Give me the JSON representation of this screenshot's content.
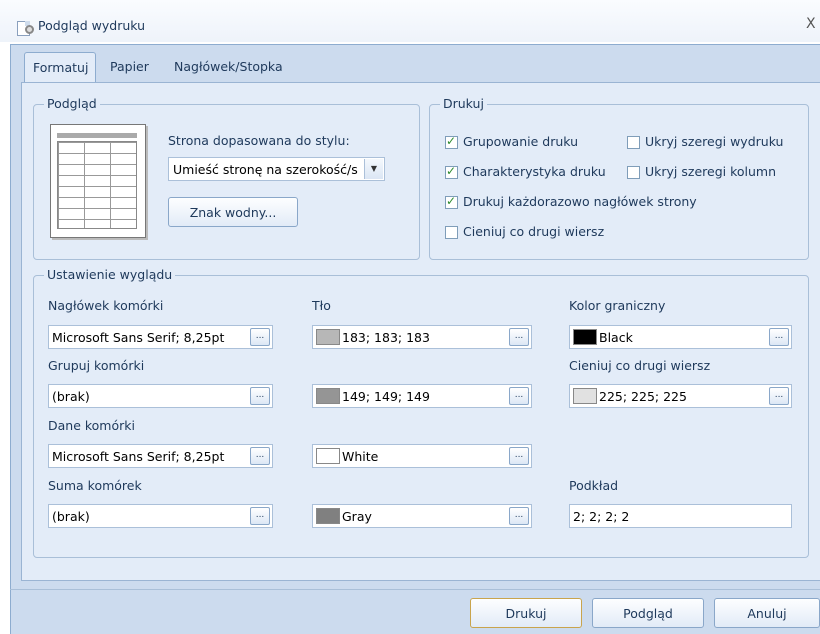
{
  "window": {
    "title": "Podgląd wydruku",
    "close_glyph": "X"
  },
  "tabs": [
    {
      "label": "Formatuj",
      "active": true
    },
    {
      "label": "Papier",
      "active": false
    },
    {
      "label": "Nagłówek/Stopka",
      "active": false
    }
  ],
  "preview_group": {
    "title": "Podgląd",
    "fit_label": "Strona dopasowana do stylu:",
    "fit_value": "Umieść stronę na szerokość/s",
    "watermark_button": "Znak wodny..."
  },
  "print_group": {
    "title": "Drukuj",
    "options": [
      {
        "label": "Grupowanie druku",
        "checked": true
      },
      {
        "label": "Ukryj szeregi wydruku",
        "checked": false
      },
      {
        "label": "Charakterystyka druku",
        "checked": true
      },
      {
        "label": "Ukryj szeregi kolumn",
        "checked": false
      },
      {
        "label": "Drukuj każdorazowo nagłówek strony",
        "checked": true
      },
      {
        "label": "Cieniuj co drugi wiersz",
        "checked": false
      }
    ]
  },
  "appearance_group": {
    "title": "Ustawienie wyglądu",
    "labels": {
      "header_cell": "Nagłówek komórki",
      "background": "Tło",
      "border_color": "Kolor graniczny",
      "group_cells": "Grupuj komórki",
      "shade_alt": "Cieniuj co drugi wiersz",
      "data_cells": "Dane komórki",
      "sum_cells": "Suma komórek",
      "underlay": "Podkład"
    },
    "fonts": {
      "header_cell": "Microsoft Sans Serif; 8,25pt",
      "group_cells": "(brak)",
      "data_cells": "Microsoft Sans Serif; 8,25pt",
      "sum_cells": "(brak)"
    },
    "colors": {
      "header_bg": {
        "label": "183; 183; 183",
        "hex": "#b7b7b7"
      },
      "group_bg": {
        "label": "149; 149; 149",
        "hex": "#959595"
      },
      "data_bg": {
        "label": "White",
        "hex": "#ffffff"
      },
      "sum_bg": {
        "label": "Gray",
        "hex": "#808080"
      },
      "border": {
        "label": "Black",
        "hex": "#000000"
      },
      "shade_alt": {
        "label": "225; 225; 225",
        "hex": "#e1e1e1"
      }
    },
    "underlay_value": "2; 2; 2; 2",
    "ellipsis": "..."
  },
  "buttons": {
    "print": "Drukuj",
    "preview": "Podgląd",
    "cancel": "Anuluj"
  },
  "accent": "#1e395b"
}
